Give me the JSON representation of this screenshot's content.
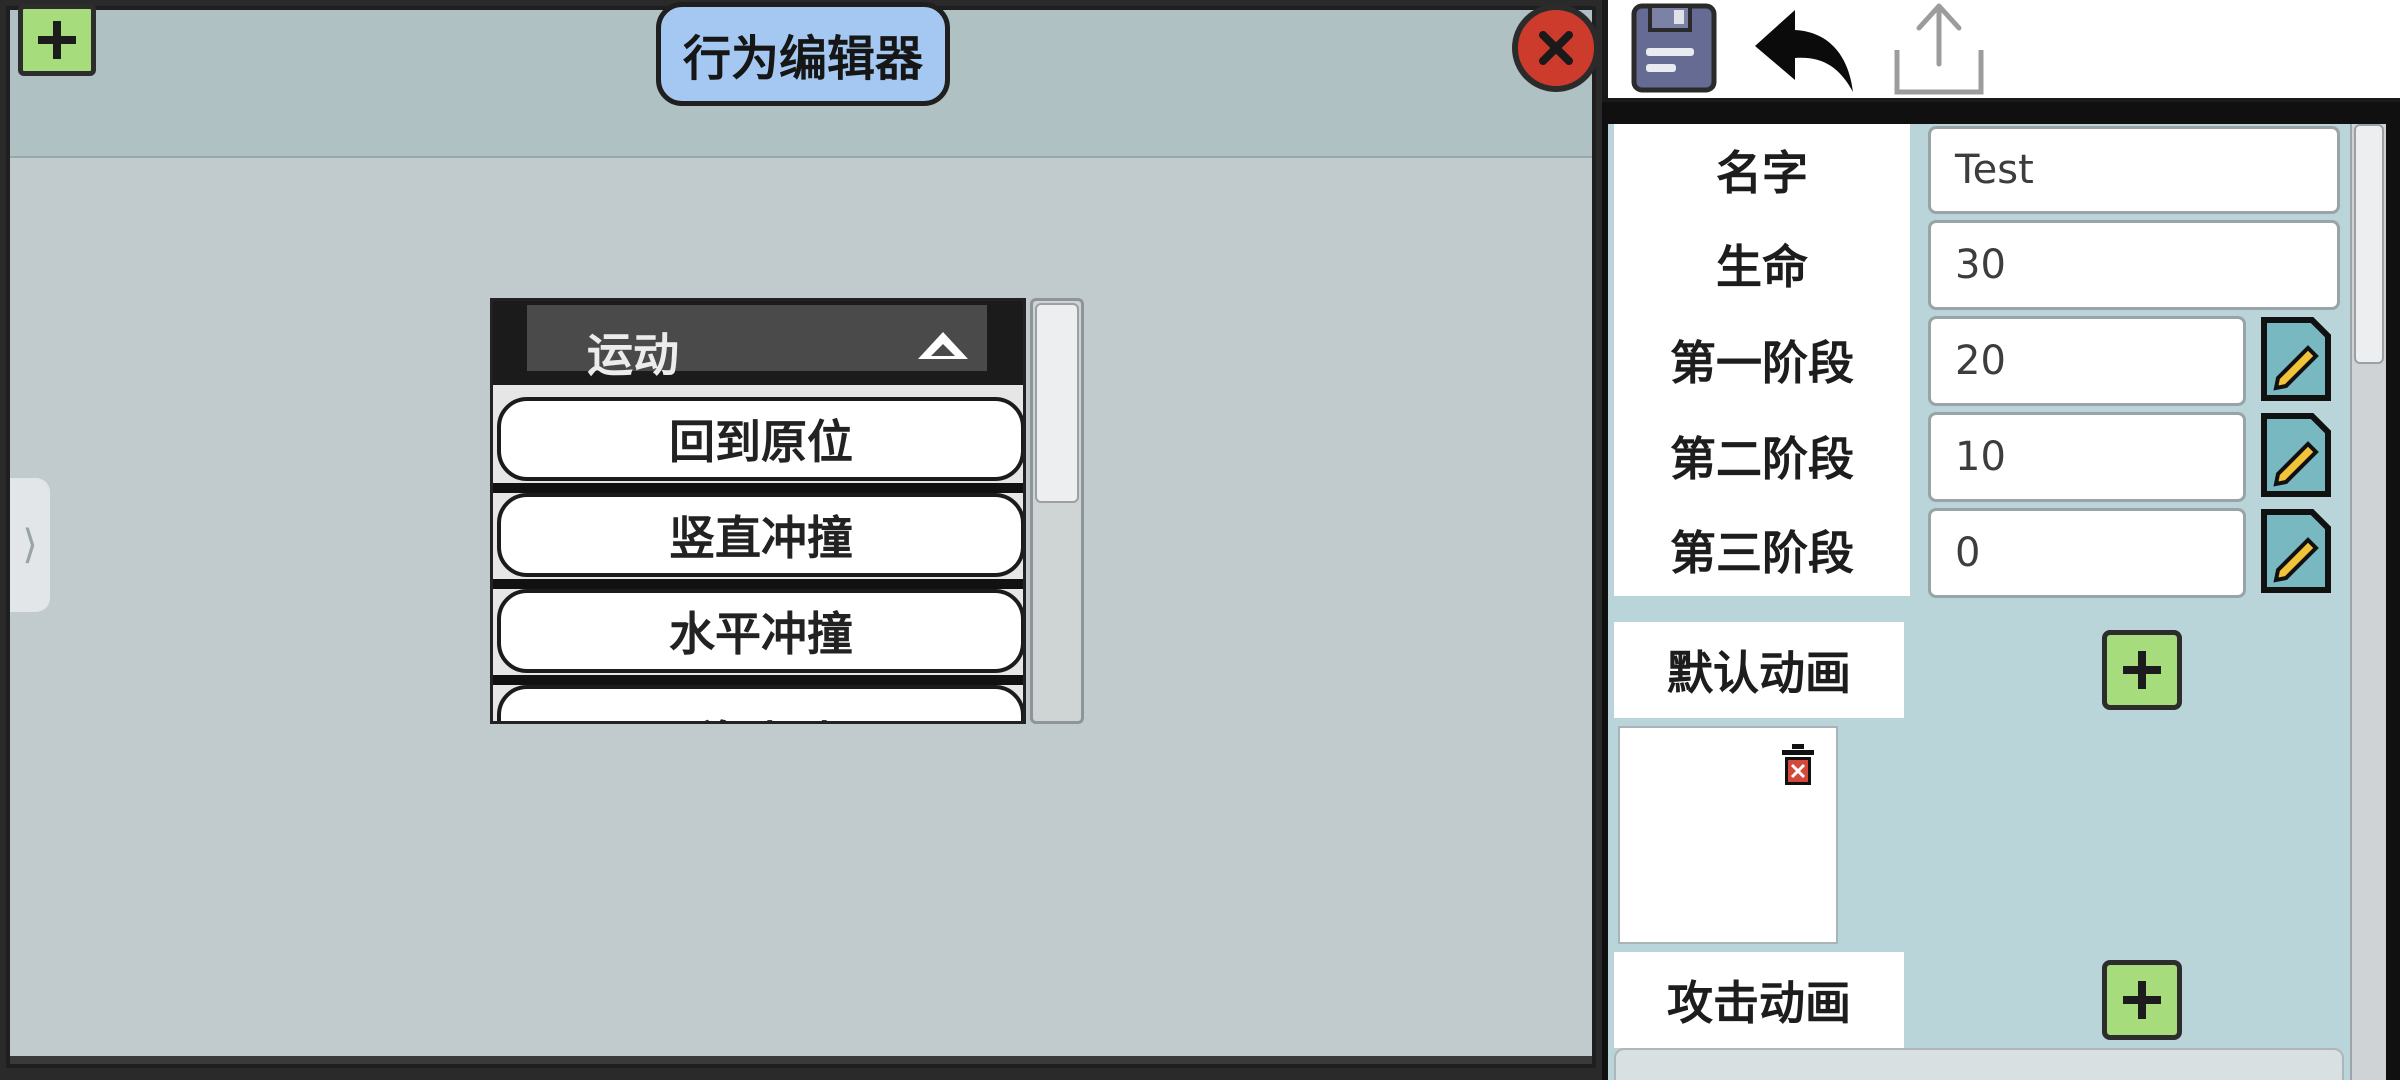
{
  "editor": {
    "title": "行为编辑器",
    "dropdown": {
      "selected": "运动",
      "items": [
        "回到原位",
        "竖直冲撞",
        "水平冲撞",
        "移动到"
      ]
    },
    "side_tab_glyph": "⟩"
  },
  "toolbar": {
    "icons": [
      "save-icon",
      "undo-icon",
      "export-icon"
    ]
  },
  "properties": {
    "name_label": "名字",
    "name_value": "Test",
    "life_label": "生命",
    "life_value": "30",
    "stage1_label": "第一阶段",
    "stage1_value": "20",
    "stage2_label": "第二阶段",
    "stage2_value": "10",
    "stage3_label": "第三阶段",
    "stage3_value": "0",
    "default_anim_label": "默认动画",
    "attack_anim_label": "攻击动画"
  },
  "colors": {
    "add_green": "#a6dc7c",
    "title_blue": "#a4c8f2",
    "close_red": "#cc3b2c",
    "panel_teal": "#b9d5d9",
    "edit_teal": "#78b9c1"
  }
}
